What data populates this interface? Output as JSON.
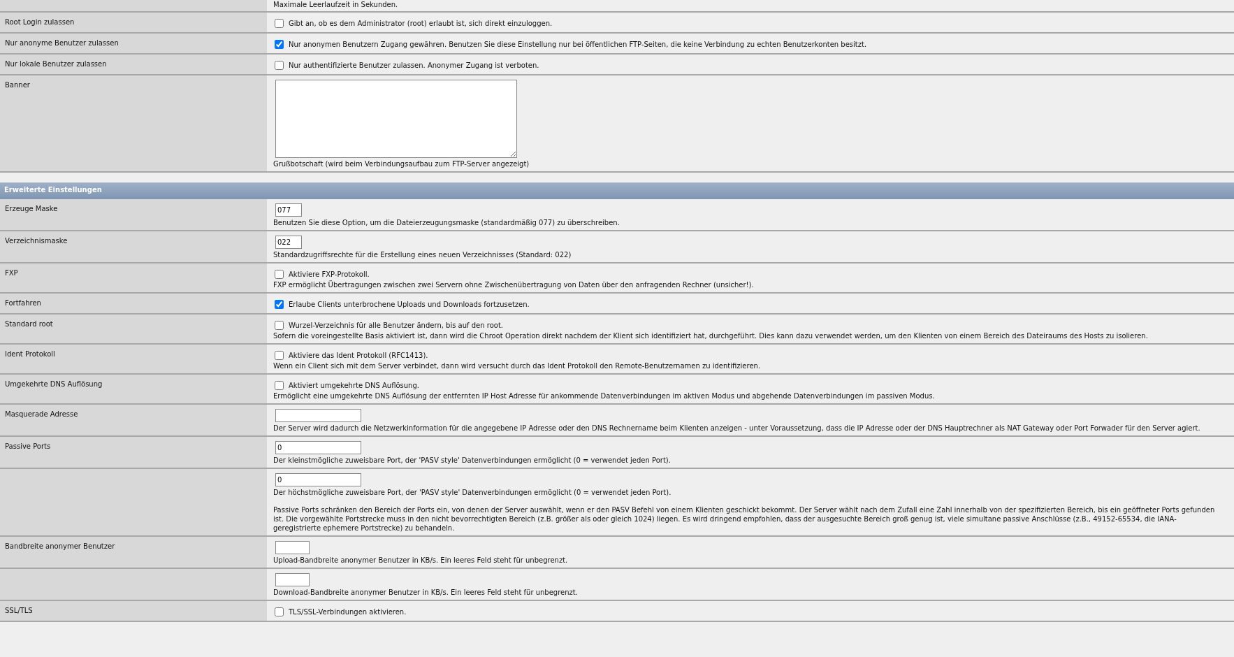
{
  "sections": [
    {
      "rows": [
        {
          "kind": "note",
          "description": "Maximale Leerlaufzeit in Sekunden."
        },
        {
          "label": "Root Login zulassen",
          "kind": "checkbox",
          "checked": false,
          "text": "Gibt an, ob es dem Administrator (root) erlaubt ist, sich direkt einzuloggen."
        },
        {
          "label": "Nur anonyme Benutzer zulassen",
          "kind": "checkbox",
          "checked": true,
          "text": "Nur anonymen Benutzern Zugang gewähren. Benutzen Sie diese Einstellung nur bei öffentlichen FTP-Seiten, die keine Verbindung zu echten Benutzerkonten besitzt."
        },
        {
          "label": "Nur lokale Benutzer zulassen",
          "kind": "checkbox",
          "checked": false,
          "text": "Nur authentifizierte Benutzer zulassen. Anonymer Zugang ist verboten."
        },
        {
          "label": "Banner",
          "kind": "textarea",
          "description": "Grußbotschaft (wird beim Verbindungsaufbau zum FTP-Server angezeigt)"
        }
      ]
    },
    {
      "title": "Erweiterte Einstellungen",
      "rows": [
        {
          "label": "Erzeuge Maske",
          "kind": "code-input",
          "value": "077",
          "description": "Benutzen Sie diese Option, um die Dateierzeugungsmaske (standardmäßig 077) zu überschreiben."
        },
        {
          "label": "Verzeichnismaske",
          "kind": "code-input",
          "value": "022",
          "description": "Standardzugriffsrechte für die Erstellung eines neuen Verzeichnisses (Standard: 022)"
        },
        {
          "label": "FXP",
          "kind": "checkbox",
          "checked": false,
          "text": "Aktiviere FXP-Protokoll.",
          "description": "FXP ermöglicht Übertragungen zwischen zwei Servern ohne Zwischenübertragung von Daten über den anfragenden Rechner (unsicher!)."
        },
        {
          "label": "Fortfahren",
          "kind": "checkbox",
          "checked": true,
          "text": "Erlaube Clients unterbrochene Uploads und Downloads fortzusetzen."
        },
        {
          "label": "Standard root",
          "kind": "checkbox",
          "checked": false,
          "text": "Wurzel-Verzeichnis für alle Benutzer ändern, bis auf den root.",
          "description": "Sofern die voreingestellte Basis aktiviert ist, dann wird die Chroot Operation direkt nachdem der Klient sich identifiziert hat, durchgeführt. Dies kann dazu verwendet werden, um den Klienten von einem Bereich des Dateiraums des Hosts zu isolieren."
        },
        {
          "label": "Ident Protokoll",
          "kind": "checkbox",
          "checked": false,
          "text": "Aktiviere das Ident Protokoll (RFC1413).",
          "description": "Wenn ein Client sich mit dem Server verbindet, dann wird versucht durch das Ident Protokoll den Remote-Benutzernamen zu identifizieren."
        },
        {
          "label": "Umgekehrte DNS Auflösung",
          "kind": "checkbox",
          "checked": false,
          "text": "Aktiviert umgekehrte DNS Auflösung.",
          "description": "Ermöglicht eine umgekehrte DNS Auflösung der entfernten IP Host Adresse für ankommende Datenverbindungen im aktiven Modus und abgehende Datenverbindungen im passiven Modus."
        },
        {
          "label": "Masquerade Adresse",
          "kind": "input",
          "description": "Der Server wird dadurch die Netzwerkinformation für die angegebene IP Adresse oder den DNS Rechnername beim Klienten anzeigen - unter Voraussetzung, dass die IP Adresse oder der DNS Hauptrechner als NAT Gateway oder Port Forwader für den Server agiert."
        },
        {
          "label": "Passive Ports",
          "kind": "input",
          "value": "0",
          "description": "Der kleinstmögliche zuweisbare Port, der 'PASV style' Datenverbindungen ermöglicht (0 = verwendet jeden Port)."
        },
        {
          "kind": "input",
          "value": "0",
          "description": "Der höchstmögliche zuweisbare Port, der 'PASV style' Datenverbindungen ermöglicht (0 = verwendet jeden Port).",
          "note": "Passive Ports schränken den Bereich der Ports ein, von denen der Server auswählt, wenn er den PASV Befehl von einem Klienten geschickt bekommt. Der Server wählt nach dem Zufall eine Zahl innerhalb von der spezifizierten Bereich, bis ein geöffneter Ports gefunden ist. Die vorgewählte Portstrecke muss in den nicht bevorrechtigten Bereich (z.B. größer als oder gleich 1024) liegen. Es wird dringend empfohlen, dass der ausgesuchte Bereich groß genug ist, viele simultane passive Anschlüsse (z.B., 49152-65534, die IANA-geregistrierte ephemere Portstrecke) zu behandeln."
        },
        {
          "label": "Bandbreite anonymer Benutzer",
          "kind": "number-input",
          "description": "Upload-Bandbreite anonymer Benutzer in KB/s. Ein leeres Feld steht für unbegrenzt."
        },
        {
          "kind": "number-input",
          "description": "Download-Bandbreite anonymer Benutzer in KB/s. Ein leeres Feld steht für unbegrenzt."
        },
        {
          "label": "SSL/TLS",
          "kind": "checkbox",
          "checked": false,
          "text": "TLS/SSL-Verbindungen aktivieren."
        }
      ]
    }
  ]
}
